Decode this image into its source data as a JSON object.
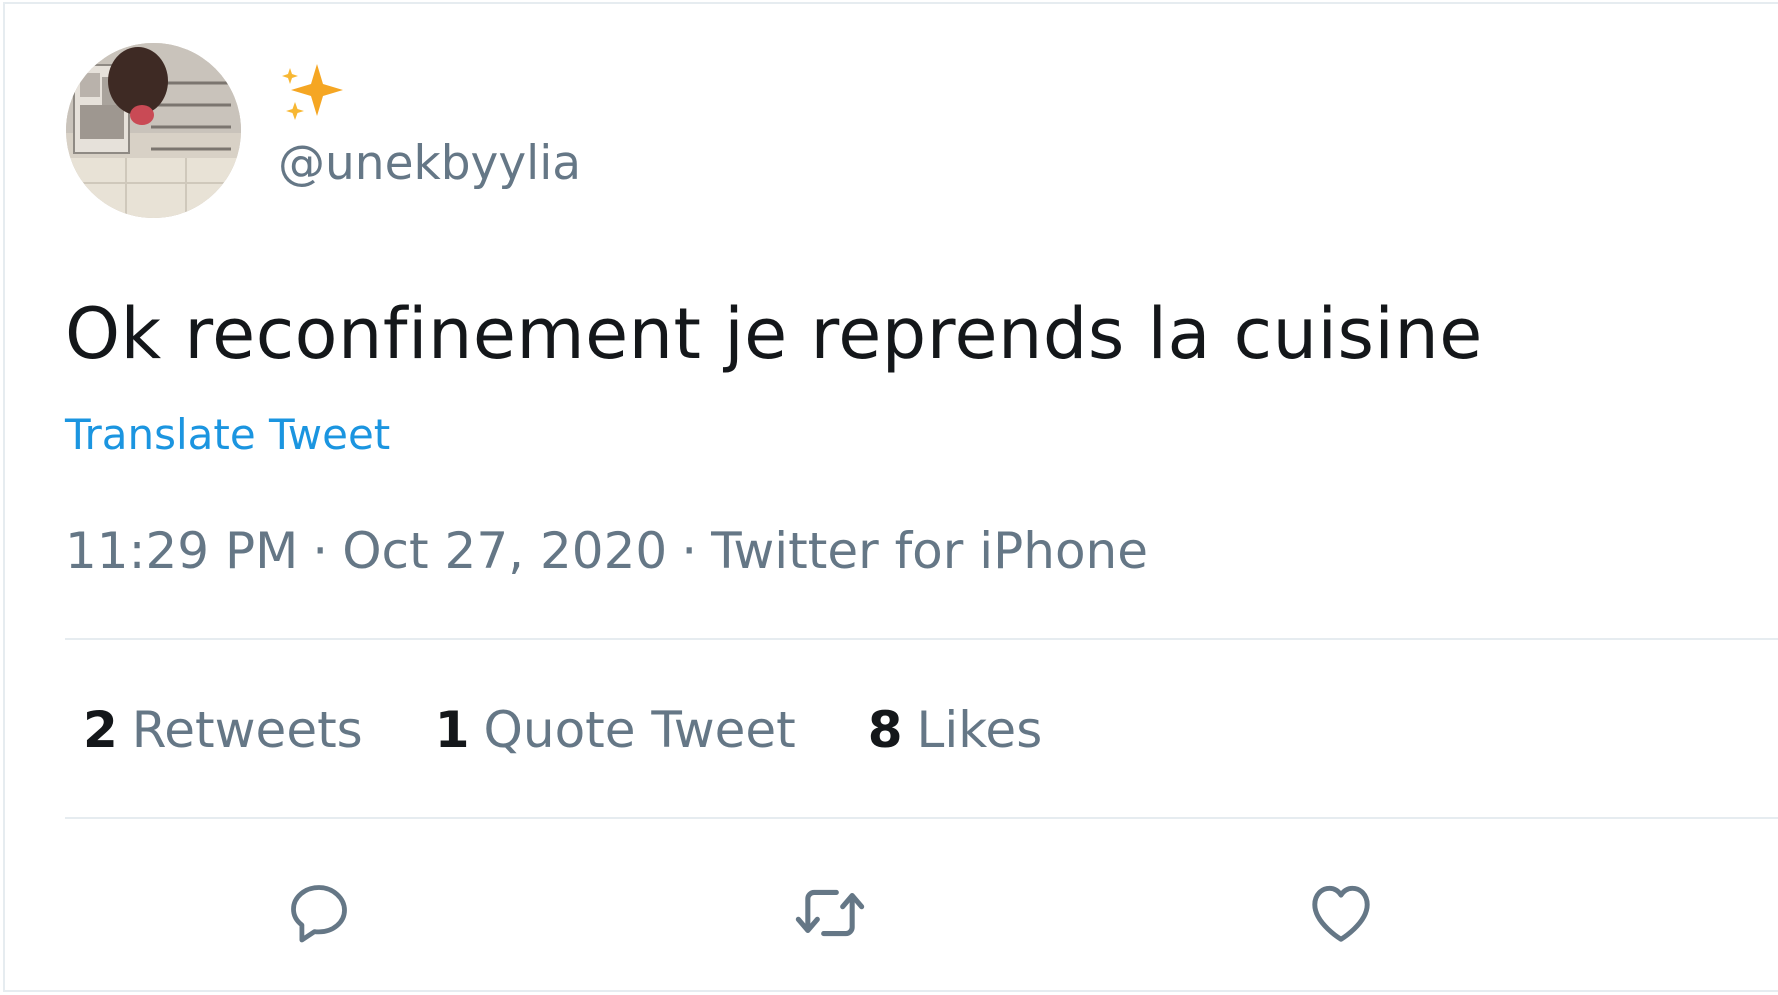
{
  "author": {
    "display_name": "✨",
    "handle": "@unekbyylia"
  },
  "tweet": {
    "text": "Ok reconfinement je reprends la cuisine",
    "translate_label": "Translate Tweet",
    "time": "11:29 PM",
    "date": "Oct 27, 2020",
    "source": "Twitter for iPhone",
    "separator": "·"
  },
  "stats": {
    "retweets": {
      "count": "2",
      "label": "Retweets"
    },
    "quote_tweets": {
      "count": "1",
      "label": "Quote Tweet"
    },
    "likes": {
      "count": "8",
      "label": "Likes"
    }
  },
  "actions": {
    "reply_icon": "reply-icon",
    "retweet_icon": "retweet-icon",
    "like_icon": "heart-icon"
  },
  "colors": {
    "text_primary": "#14171a",
    "text_secondary": "#657786",
    "link": "#1b95e0",
    "divider": "#e6ecf0",
    "sparkle": "#f5a623"
  }
}
